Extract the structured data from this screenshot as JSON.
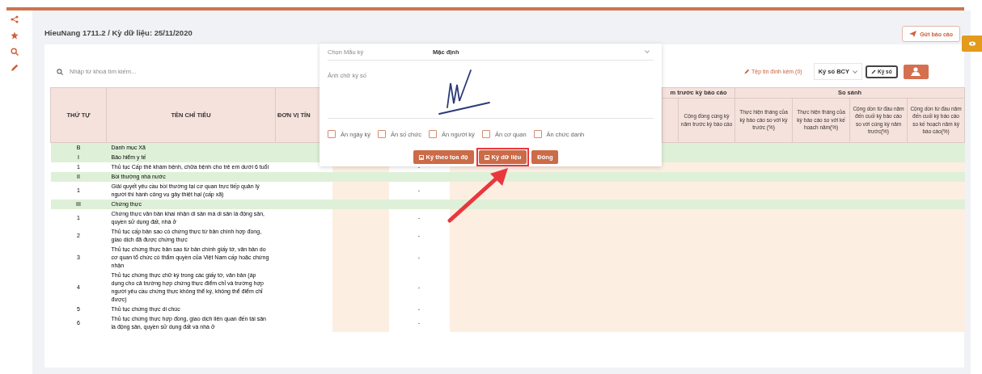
{
  "header": {
    "title": "HieuNang 1711.2 / Kỳ dữ liệu: 25/11/2020",
    "send_button": "Gửi báo cáo"
  },
  "toolbar": {
    "search": {
      "placeholder": "Nhập từ khoá tìm kiếm..."
    },
    "attachments": "Tệp tin đính kèm (0)",
    "sign_type": "Ký số BCY",
    "sign_button": "Ký số"
  },
  "table": {
    "order_header": "THỨ TỰ",
    "name_header": "TÊN CHỈ TIÊU",
    "unit_header": "ĐƠN VỊ TÍN",
    "group_headers": [
      "m trước kỳ báo cáo",
      "So sánh"
    ],
    "sub_headers": [
      "Cộng đồng cùng kỳ năm trước kỳ báo cáo",
      "Thực hiện tháng của kỳ báo cáo so với kỳ trước (%)",
      "Thực hiện tháng của kỳ báo cáo so với kế hoạch năm(%)",
      "Cộng dồn từ đầu năm đến cuối kỳ báo cáo so với cùng kỳ năm trước(%)",
      "Cộng dồn từ đầu năm đến cuối kỳ báo cáo so kế hoạch năm kỳ báo cáo(%)"
    ],
    "rows": [
      {
        "kind": "group",
        "order": "B",
        "name": "Danh mục Xã"
      },
      {
        "kind": "group",
        "order": "I",
        "name": "Bảo hiểm y tế"
      },
      {
        "kind": "item",
        "order": "1",
        "name": "Thủ tục Cấp thẻ khám bệnh, chữa bệnh cho trẻ em dưới 6 tuổi",
        "value": "-"
      },
      {
        "kind": "group",
        "order": "II",
        "name": "Bồi thường nhà nước"
      },
      {
        "kind": "item",
        "order": "1",
        "name": "Giải quyết yêu cầu bồi thường tại cơ quan trực tiếp quản lý người thi hành công vụ gây thiệt hại (cấp xã)",
        "value": "-"
      },
      {
        "kind": "group",
        "order": "III",
        "name": "Chứng thực"
      },
      {
        "kind": "item",
        "order": "1",
        "name": "Chứng thực văn bản khai nhận di sản mà di sản là động sản, quyền sử dụng đất, nhà ở",
        "value": "-"
      },
      {
        "kind": "item",
        "order": "2",
        "name": "Thủ tục cấp bản sao có chứng thực từ bản chính hợp đồng, giao dịch đã được chứng thực",
        "value": "-"
      },
      {
        "kind": "item",
        "order": "3",
        "name": "Thủ tục chứng thực bản sao từ bản chính giấy tờ, văn bản do cơ quan tổ chức có thẩm quyền của Việt Nam cấp hoặc chứng nhận",
        "value": "-"
      },
      {
        "kind": "item",
        "order": "4",
        "name": "Thủ tục chứng thực chữ ký trong các giấy tờ, văn bản (áp dụng cho cả trường hợp chứng thực điểm chỉ và trường hợp người yêu cầu chứng thực không thể ký, không thể điểm chỉ được)",
        "value": "-"
      },
      {
        "kind": "item",
        "order": "5",
        "name": "Thủ tục chứng thực di chúc",
        "value": "-"
      },
      {
        "kind": "item",
        "order": "6",
        "name": "Thủ tục chứng thực hợp đồng, giao dịch liên quan đến tài sản là động sản, quyền sử dụng đất và nhà ở",
        "value": "-"
      }
    ]
  },
  "dialog": {
    "template_label": "Chọn Mẫu ký",
    "template_value": "Mặc định",
    "signature_label": "Ảnh chữ ký số",
    "options": [
      {
        "label": "Ẩn ngày ký",
        "checked": false
      },
      {
        "label": "Ẩn số chức",
        "checked": false
      },
      {
        "label": "Ẩn người ký",
        "checked": false
      },
      {
        "label": "Ẩn cơ quan",
        "checked": false
      },
      {
        "label": "Ẩn chức danh",
        "checked": false
      }
    ],
    "buttons": [
      {
        "label": "Ký theo tọa độ",
        "highlighted": false
      },
      {
        "label": "Ký dữ liệu",
        "highlighted": true
      },
      {
        "label": "Đóng",
        "highlighted": false
      }
    ]
  }
}
